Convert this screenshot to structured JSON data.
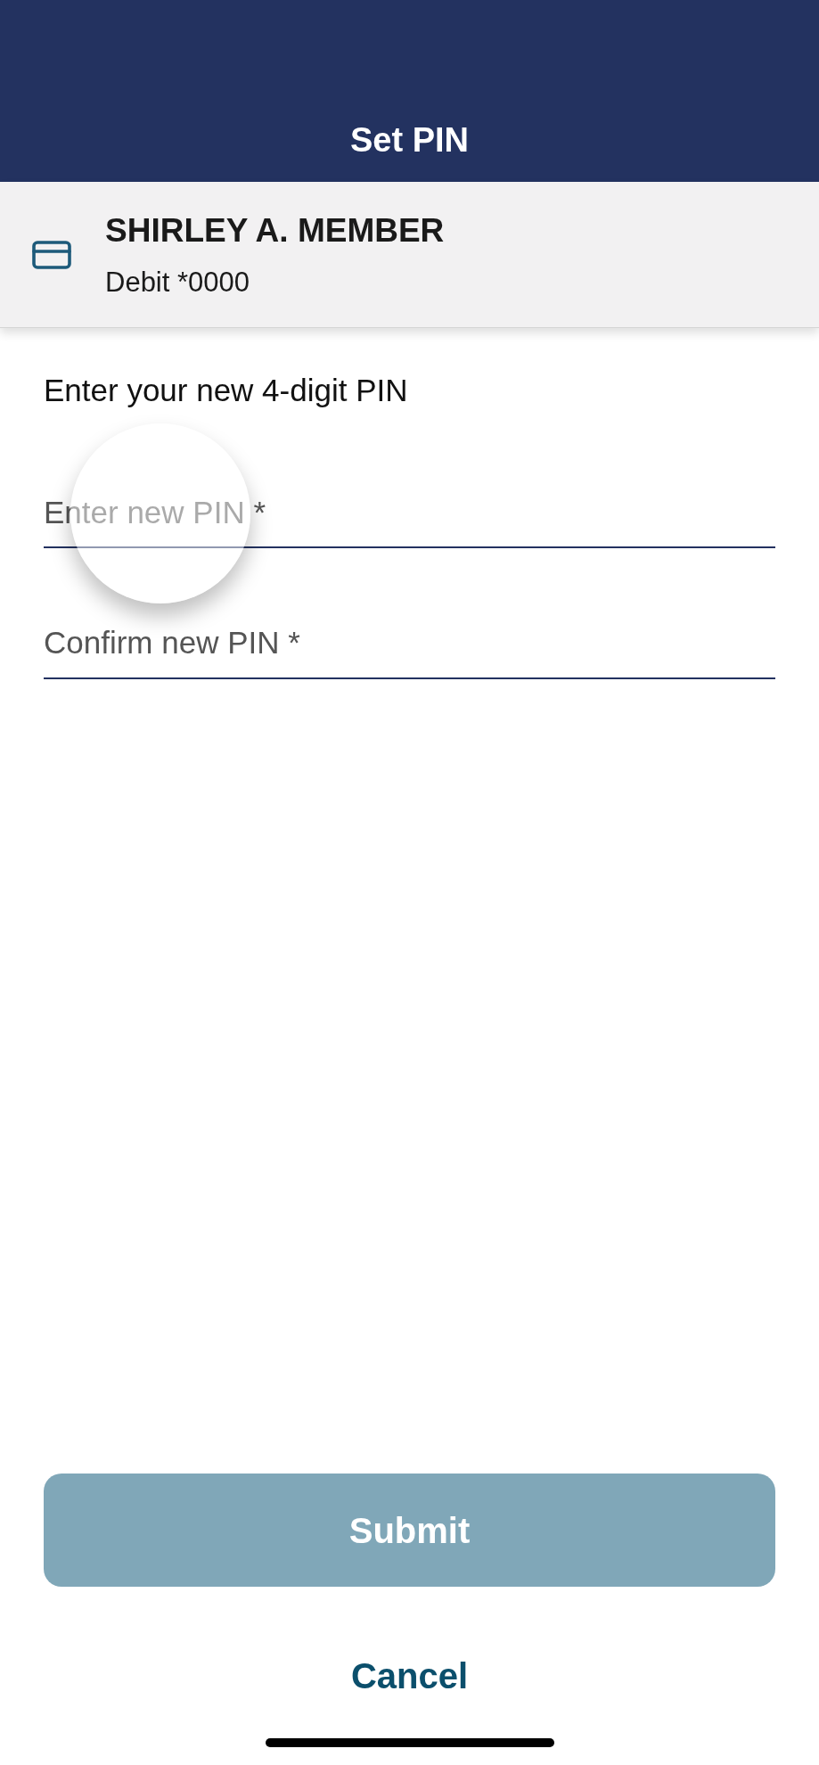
{
  "header": {
    "title": "Set PIN"
  },
  "account": {
    "name": "SHIRLEY A. MEMBER",
    "card": "Debit *0000"
  },
  "instruction": "Enter your new 4-digit PIN",
  "fields": [
    {
      "placeholder": "Enter new PIN *",
      "touched": true
    },
    {
      "placeholder": "Confirm new PIN *",
      "touched": false
    }
  ],
  "submit": {
    "label": "Submit",
    "disabled": true
  },
  "cancel": {
    "label": "Cancel"
  }
}
